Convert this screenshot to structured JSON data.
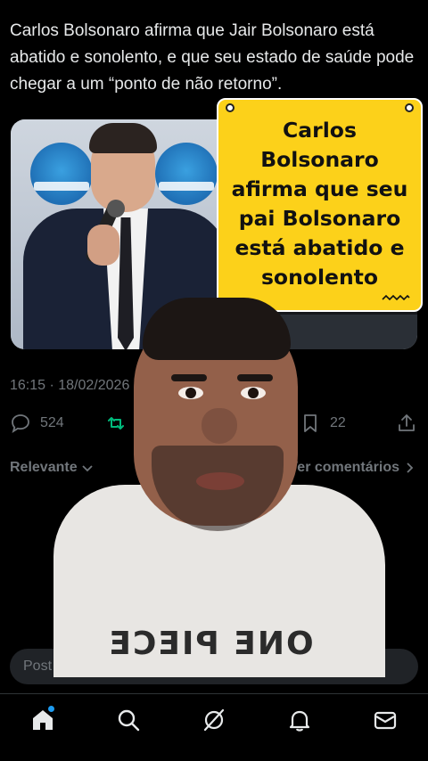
{
  "tweet": {
    "text": "Carlos Bolsonaro afirma que Jair Bolsonaro está abatido e sonolento, e que seu estado de saúde pode chegar a um “ponto de não retorno”.",
    "timestamp": "16:15 · 18/02/2026"
  },
  "sticker": {
    "text": "Carlos Bolsonaro afirma que seu pai Bolsonaro está abatido e sonolento",
    "color": "#fcd11a"
  },
  "actions": {
    "replies": "524",
    "reposts": "",
    "likes": "",
    "bookmarks": "22",
    "icons": [
      "reply-icon",
      "repost-icon",
      "bookmark-icon",
      "share-icon"
    ],
    "repost_color": "#00ba7c"
  },
  "sort": {
    "left_label": "Relevante",
    "right_label": "Ver comentários"
  },
  "reply": {
    "placeholder": "Post"
  },
  "bottom_nav": {
    "items": [
      "home-icon",
      "search-icon",
      "grok-icon",
      "notifications-icon",
      "messages-icon"
    ],
    "accent": "#1d9bf0"
  },
  "overlay": {
    "shirt_print": "ONE PIECE"
  }
}
